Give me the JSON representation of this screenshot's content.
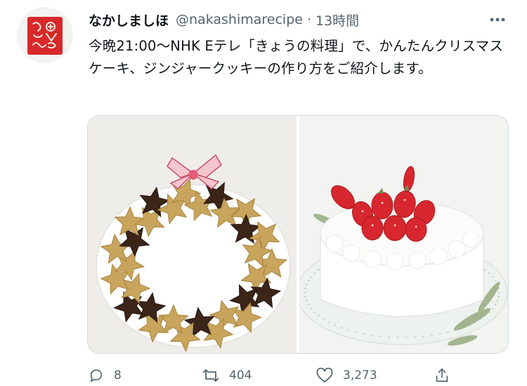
{
  "tweet": {
    "display_name": "なかしましほ",
    "handle": "@nakashimarecipe",
    "separator": "·",
    "time": "13時間",
    "text": "今晩21:00〜NHK Eテレ「きょうの料理」で、かんたんクリスマスケーキ、ジンジャークッキーの作り方をご紹介します。"
  },
  "icons": {
    "more": "more-icon",
    "reply": "reply-icon",
    "retweet": "retweet-icon",
    "like": "heart-icon",
    "share": "share-icon"
  },
  "actions": {
    "reply_count": "8",
    "retweet_count": "404",
    "like_count": "3,273"
  },
  "colors": {
    "text": "#0f1419",
    "secondary": "#536471",
    "border": "#cfd9de",
    "avatar_stamp": "#d7282a"
  }
}
